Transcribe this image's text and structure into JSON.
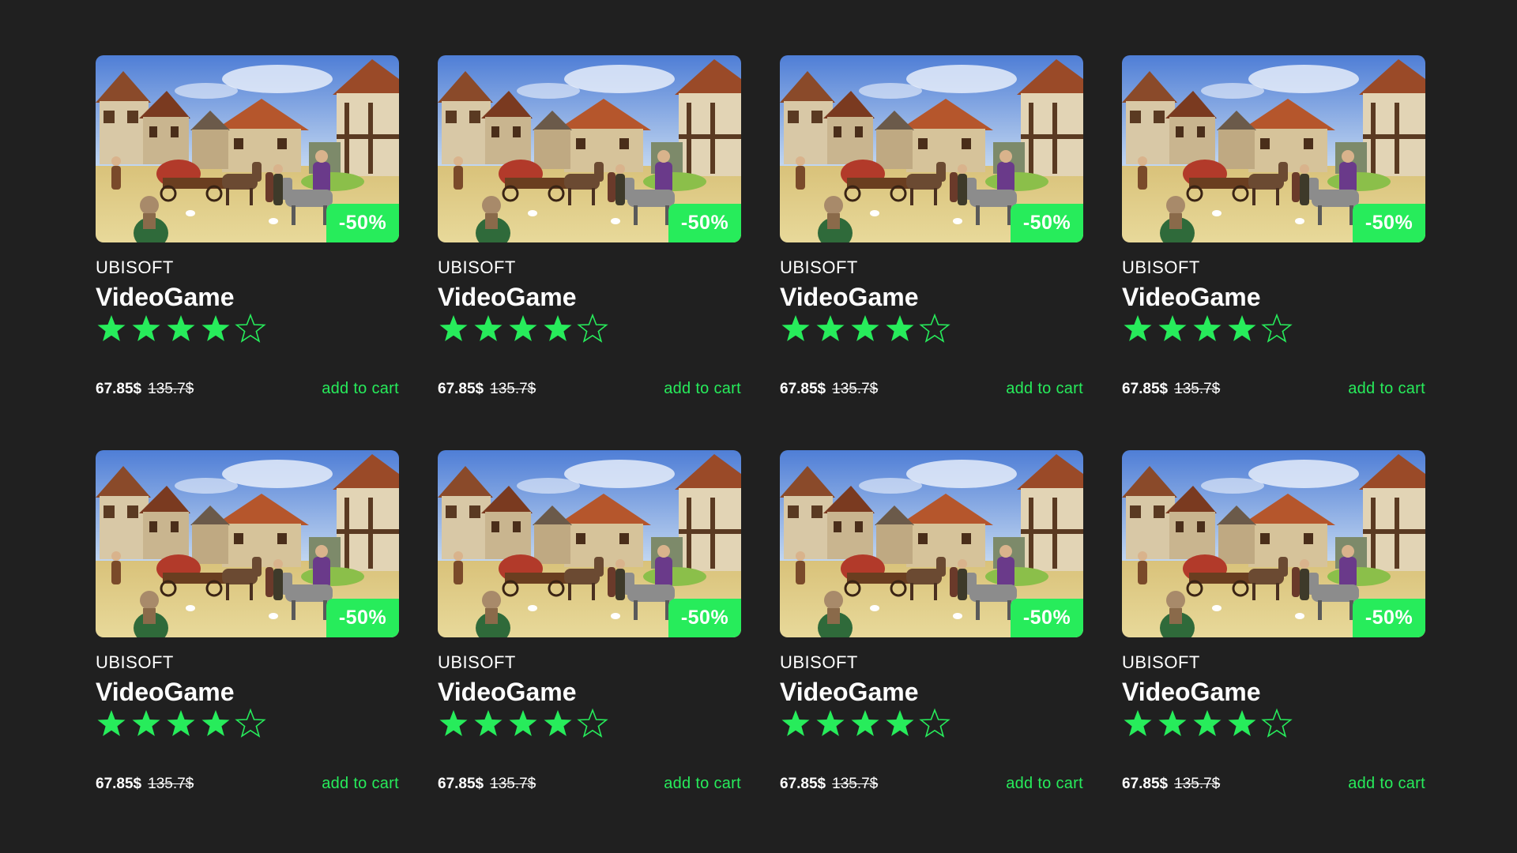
{
  "colors": {
    "background": "#202020",
    "accent": "#27ec5b",
    "text": "#ffffff"
  },
  "products": [
    {
      "publisher": "UBISOFT",
      "title": "VideoGame",
      "discount": "-50%",
      "rating": 4,
      "rating_max": 5,
      "price": "67.85$",
      "old_price": "135.7$",
      "cart_label": "add to cart",
      "image": "medieval-village-game-screenshot"
    },
    {
      "publisher": "UBISOFT",
      "title": "VideoGame",
      "discount": "-50%",
      "rating": 4,
      "rating_max": 5,
      "price": "67.85$",
      "old_price": "135.7$",
      "cart_label": "add to cart",
      "image": "medieval-village-game-screenshot"
    },
    {
      "publisher": "UBISOFT",
      "title": "VideoGame",
      "discount": "-50%",
      "rating": 4,
      "rating_max": 5,
      "price": "67.85$",
      "old_price": "135.7$",
      "cart_label": "add to cart",
      "image": "medieval-village-game-screenshot"
    },
    {
      "publisher": "UBISOFT",
      "title": "VideoGame",
      "discount": "-50%",
      "rating": 4,
      "rating_max": 5,
      "price": "67.85$",
      "old_price": "135.7$",
      "cart_label": "add to cart",
      "image": "medieval-village-game-screenshot"
    },
    {
      "publisher": "UBISOFT",
      "title": "VideoGame",
      "discount": "-50%",
      "rating": 4,
      "rating_max": 5,
      "price": "67.85$",
      "old_price": "135.7$",
      "cart_label": "add to cart",
      "image": "medieval-village-game-screenshot"
    },
    {
      "publisher": "UBISOFT",
      "title": "VideoGame",
      "discount": "-50%",
      "rating": 4,
      "rating_max": 5,
      "price": "67.85$",
      "old_price": "135.7$",
      "cart_label": "add to cart",
      "image": "medieval-village-game-screenshot"
    },
    {
      "publisher": "UBISOFT",
      "title": "VideoGame",
      "discount": "-50%",
      "rating": 4,
      "rating_max": 5,
      "price": "67.85$",
      "old_price": "135.7$",
      "cart_label": "add to cart",
      "image": "medieval-village-game-screenshot"
    },
    {
      "publisher": "UBISOFT",
      "title": "VideoGame",
      "discount": "-50%",
      "rating": 4,
      "rating_max": 5,
      "price": "67.85$",
      "old_price": "135.7$",
      "cart_label": "add to cart",
      "image": "medieval-village-game-screenshot"
    }
  ]
}
